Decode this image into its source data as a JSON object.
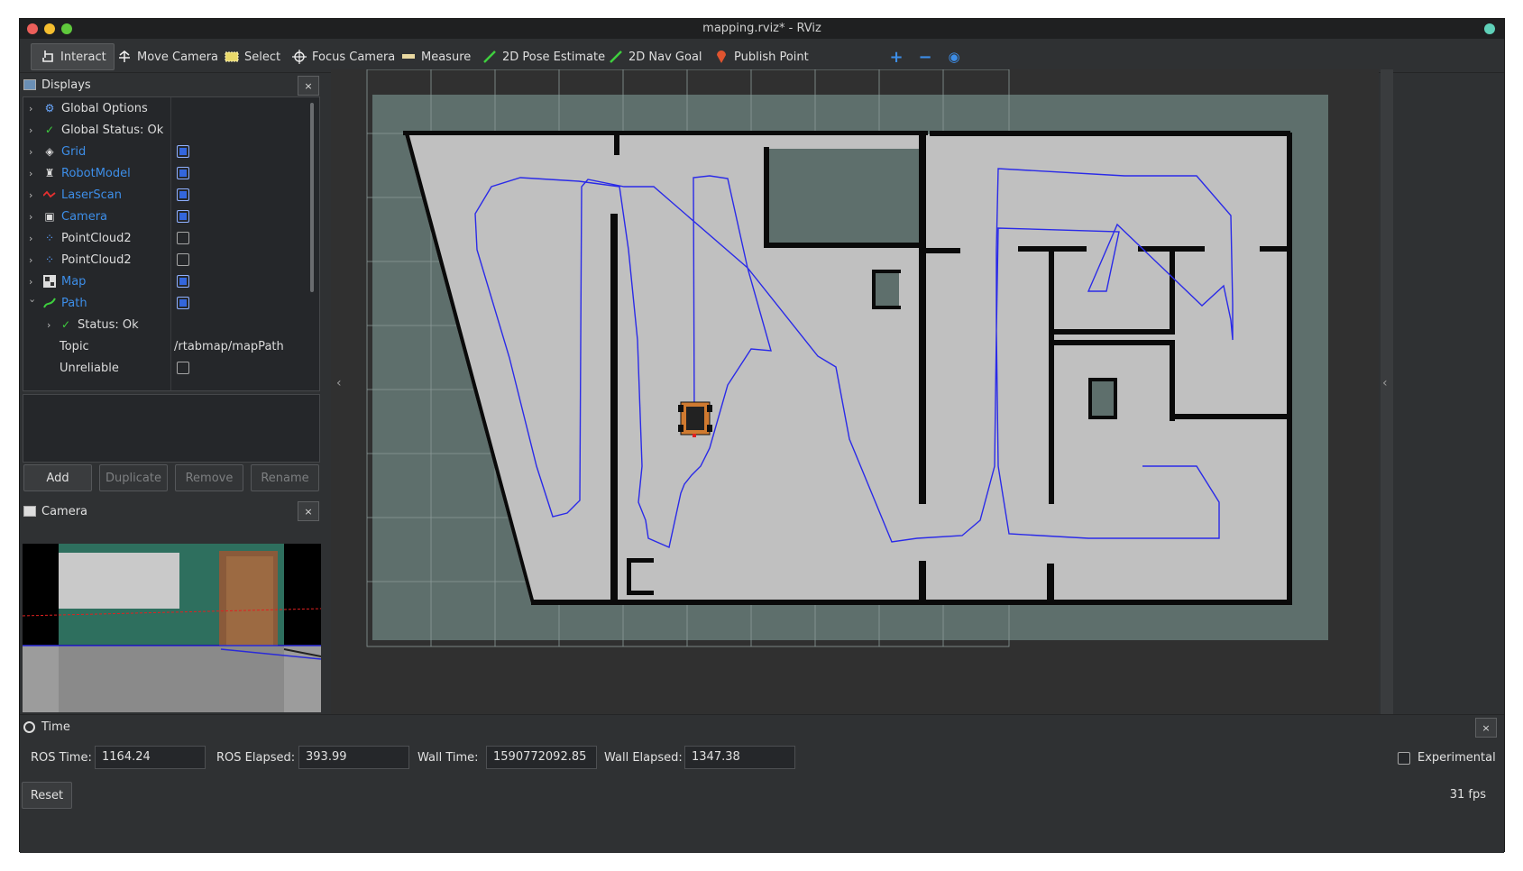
{
  "window": {
    "title": "mapping.rviz* - RViz"
  },
  "toolbar": {
    "tools": [
      {
        "label": "Interact",
        "icon": "cursor-hand-icon",
        "active": true
      },
      {
        "label": "Move Camera",
        "icon": "move-camera-icon"
      },
      {
        "label": "Select",
        "icon": "select-icon"
      },
      {
        "label": "Focus Camera",
        "icon": "crosshair-icon"
      },
      {
        "label": "Measure",
        "icon": "ruler-icon"
      },
      {
        "label": "2D Pose Estimate",
        "icon": "green-arrow-icon"
      },
      {
        "label": "2D Nav Goal",
        "icon": "green-arrow-icon"
      },
      {
        "label": "Publish Point",
        "icon": "map-pin-icon"
      }
    ],
    "plus": "+",
    "minus": "−",
    "eye": "◉"
  },
  "displays": {
    "title": "Displays",
    "close": "×",
    "rows": [
      {
        "label": "Global Options",
        "icon": "gear-icon"
      },
      {
        "label": "Global Status: Ok",
        "icon": "check-icon"
      },
      {
        "label": "Grid",
        "icon": "grid-icon",
        "checked": true
      },
      {
        "label": "RobotModel",
        "icon": "robot-icon",
        "checked": true
      },
      {
        "label": "LaserScan",
        "icon": "laser-icon",
        "checked": true
      },
      {
        "label": "Camera",
        "icon": "camera-icon",
        "checked": true
      },
      {
        "label": "PointCloud2",
        "icon": "pointcloud-icon",
        "checked": false
      },
      {
        "label": "PointCloud2",
        "icon": "pointcloud-icon",
        "checked": false
      },
      {
        "label": "Map",
        "icon": "map-icon",
        "checked": true
      },
      {
        "label": "Path",
        "icon": "path-icon",
        "checked": true,
        "expanded": true
      }
    ],
    "path_children": {
      "status": "Status: Ok",
      "topic_label": "Topic",
      "topic_value": "/rtabmap/mapPath",
      "unreliable_label": "Unreliable"
    },
    "buttons": {
      "add": "Add",
      "duplicate": "Duplicate",
      "remove": "Remove",
      "rename": "Rename"
    }
  },
  "camera_panel": {
    "title": "Camera",
    "close": "×"
  },
  "time": {
    "title": "Time",
    "close": "×",
    "ros_time_label": "ROS Time:",
    "ros_time": "1164.24",
    "ros_elapsed_label": "ROS Elapsed:",
    "ros_elapsed": "393.99",
    "wall_time_label": "Wall Time:",
    "wall_time": "1590772092.85",
    "wall_elapsed_label": "Wall Elapsed:",
    "wall_elapsed": "1347.38",
    "experimental_label": "Experimental",
    "reset": "Reset",
    "fps": "31 fps"
  },
  "colors": {
    "path": "#2a2ae8",
    "map_free": "#c0c0c0",
    "map_unknown": "#5e6f6c",
    "map_wall": "#0a0a0a",
    "accent_blue": "#3d8ee8"
  }
}
